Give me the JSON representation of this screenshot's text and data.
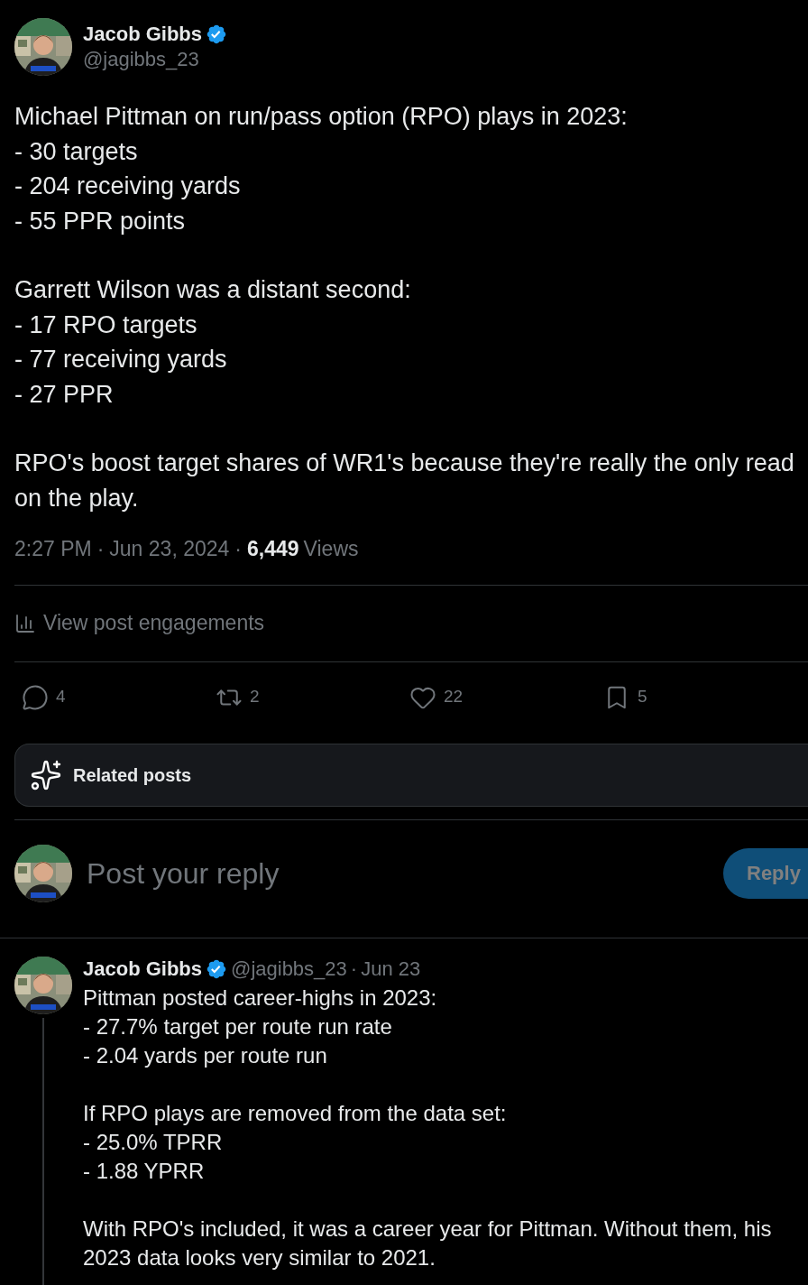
{
  "post": {
    "author": {
      "name": "Jacob Gibbs",
      "verified": true,
      "handle": "@jagibbs_23"
    },
    "paragraphs": [
      [
        "Michael Pittman on run/pass option (RPO) plays in 2023:",
        "- 30 targets",
        "- 204 receiving yards",
        "- 55 PPR points"
      ],
      [
        "Garrett Wilson was a distant second:",
        "- 17 RPO targets",
        "- 77 receiving yards",
        "- 27 PPR"
      ],
      [
        "RPO's boost target shares of WR1's because they're really the only read",
        "on the play."
      ]
    ],
    "time": "2:27 PM",
    "separator": "·",
    "date": "Jun 23, 2024",
    "separator_2": "·",
    "views_count": "6,449",
    "views_label": "Views",
    "engagements_link": "View post engagements",
    "actions": [
      {
        "kind": "reply",
        "count": "4"
      },
      {
        "kind": "repost",
        "count": "2"
      },
      {
        "kind": "like",
        "count": "22"
      },
      {
        "kind": "bookmark",
        "count": "5"
      }
    ]
  },
  "related_posts": "Related posts",
  "reply_box": {
    "placeholder": "Post your reply",
    "button": "Reply"
  },
  "replies": [
    {
      "name": "Jacob Gibbs",
      "verified": true,
      "handle": "@jagibbs_23",
      "separator": "·",
      "date": "Jun 23",
      "paragraphs": [
        [
          "Pittman posted career-highs in 2023:",
          "- 27.7% target per route run rate",
          "- 2.04 yards per route run"
        ],
        [
          "If RPO plays are removed from the data set:",
          "- 25.0% TPRR",
          "- 1.88 YPRR"
        ],
        [
          "With RPO's included, it was a career year for Pittman. Without them, his",
          "2023 data looks very similar to 2021."
        ]
      ]
    }
  ]
}
